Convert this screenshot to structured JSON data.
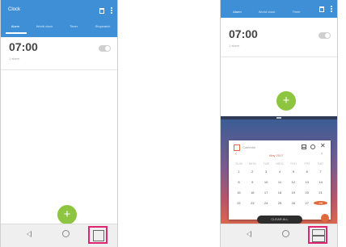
{
  "left_phone": {
    "app_title": "Clock",
    "tabs": [
      "Alarm",
      "World clock",
      "Timer",
      "Stopwatch"
    ],
    "alarm": {
      "time": "07:00",
      "sub": "1 alarm"
    },
    "fab_label": "+"
  },
  "right_phone": {
    "tabs": [
      "Alarm",
      "World clock",
      "Timer"
    ],
    "alarm": {
      "time": "07:00",
      "sub": "1 alarm"
    },
    "fab_label": "+",
    "calendar": {
      "title": "Calendar",
      "month": "May 2017",
      "prev": "‹",
      "next": "›",
      "close": "✕",
      "weekdays": [
        "SUN",
        "MON",
        "TUE",
        "WED",
        "THU",
        "FRI",
        "SAT"
      ],
      "weeks": [
        [
          "1",
          "2",
          "3",
          "4",
          "5",
          "6",
          "7"
        ],
        [
          "8",
          "9",
          "10",
          "11",
          "12",
          "13",
          "14"
        ],
        [
          "15",
          "16",
          "17",
          "18",
          "19",
          "20",
          "21"
        ],
        [
          "22",
          "23",
          "24",
          "25",
          "26",
          "27",
          "28"
        ]
      ],
      "selected_day": "28",
      "bottom_pill": "CLEAR ALL"
    }
  },
  "colors": {
    "header": "#3f8fd6",
    "fab": "#8dc540",
    "highlight_box": "#e0266f",
    "calendar_accent": "#e06a3c"
  },
  "icons": [
    "trash-icon",
    "more-icon",
    "back-icon",
    "home-icon",
    "recents-icon",
    "split-screen-icon"
  ]
}
